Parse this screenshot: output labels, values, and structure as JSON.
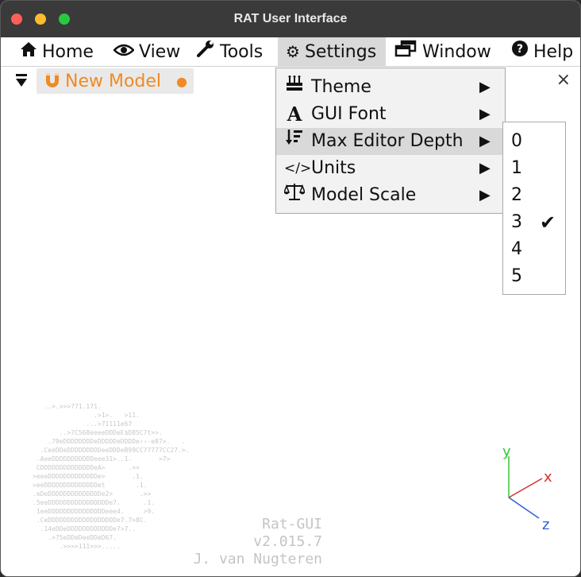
{
  "window": {
    "title": "RAT User Interface",
    "controls": {
      "close_color": "#ff5f57",
      "minimize_color": "#febc2e",
      "zoom_color": "#28c840"
    }
  },
  "menubar": {
    "items": [
      {
        "label": "Home",
        "icon": "home-icon"
      },
      {
        "label": "View",
        "icon": "eye-icon"
      },
      {
        "label": "Tools",
        "icon": "wrench-icon"
      },
      {
        "label": "Settings",
        "icon": "gear-icon",
        "active": true
      },
      {
        "label": "Window",
        "icon": "window-icon"
      },
      {
        "label": "Help",
        "icon": "help-icon"
      }
    ]
  },
  "tabs": {
    "active": {
      "label": "New Model",
      "modified_indicator": "●",
      "icon": "magnet-icon",
      "color": "#f08a24"
    },
    "close_label": "×"
  },
  "settings_menu": {
    "items": [
      {
        "label": "Theme",
        "icon": "cake-icon"
      },
      {
        "label": "GUI Font",
        "icon": "font-icon",
        "icon_glyph": "A"
      },
      {
        "label": "Max Editor Depth",
        "icon": "sort-depth-icon",
        "highlighted": true
      },
      {
        "label": "Units",
        "icon": "code-icon",
        "icon_glyph": "</>"
      },
      {
        "label": "Model Scale",
        "icon": "scale-icon"
      }
    ],
    "arrow_glyph": "▶"
  },
  "depth_submenu": {
    "items": [
      {
        "label": "0",
        "checked": false
      },
      {
        "label": "1",
        "checked": false
      },
      {
        "label": "2",
        "checked": false
      },
      {
        "label": "3",
        "checked": true
      },
      {
        "label": "4",
        "checked": false
      },
      {
        "label": "5",
        "checked": false
      }
    ],
    "check_glyph": "✔"
  },
  "splash": {
    "ascii_art": "   ..>.>>>771.171.\n                .>1>.   >11.\n              ...>71111e67\n       ..>7C568eeeeDDDeE$D85C7t>>.\n    .79eDDDDDDDDeDDDDDeDDDDe‹›-e87>.   .\n  .CeeDDeDDDDDDDDDeeDDDeB99CC77777CC27.>.\n .AeeDDDDDDDDDDDeee31>..1.       >7>\n CDDDDDDDDDDDDDDeA>      .>>\n>eeeDDDDDDDDDDDDDe>       .1.\n>eeDDDDDDDDDDDDDDet        .1.\n.eDeDDDDDDDDDDDDDDe2>       .>>\n.5eeDDDDDDDDDDDDDDDDe7.      .1.\n 1eeDDDDDDDDDDDDDDDeee4.     >9.\n .CeDDDDDDDDDDDDDDDDDDe7.7>8C.\n  .14eDDeDDDDDDDDDDDDe7>7..\n    .>75eDDeDeeDDeD67.\n       .>>>>111>>>.....",
    "app_name": "Rat-GUI",
    "version": "v2.015.7",
    "author": "J. van Nugteren"
  },
  "axes_triad": {
    "labels": {
      "y": "y",
      "x": "x",
      "z": "z"
    },
    "colors": {
      "y": "#35c435",
      "x": "#d63030",
      "z": "#2f5fd8"
    }
  }
}
